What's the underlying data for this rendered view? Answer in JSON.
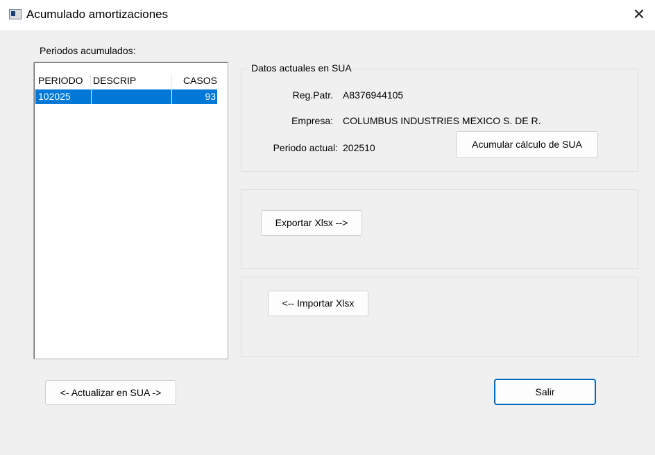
{
  "window": {
    "title": "Acumulado amortizaciones",
    "icon": "app-window-icon",
    "close_glyph": "✕"
  },
  "periods": {
    "label": "Periodos acumulados:",
    "columns": [
      "PERIODO",
      "DESCRIP",
      "CASOS"
    ],
    "rows": [
      {
        "periodo": "102025",
        "descrip": "",
        "casos": "93",
        "selected": true
      }
    ],
    "selection_color": "#0078d7"
  },
  "datos_sua": {
    "legend": "Datos actuales en SUA",
    "reg_patr_label": "Reg.Patr.",
    "reg_patr_value": "A8376944105",
    "empresa_label": "Empresa:",
    "empresa_value": "COLUMBUS INDUSTRIES MEXICO S. DE R.",
    "periodo_label": "Periodo actual:",
    "periodo_value": "202510",
    "acumular_button": "Acumular cálculo de SUA"
  },
  "export": {
    "button": "Exportar Xlsx  -->"
  },
  "import": {
    "button": "<-- Importar Xlsx"
  },
  "footer": {
    "actualizar_button": "<- Actualizar en SUA ->",
    "salir_button": "Salir",
    "focus_color": "#0067c0"
  }
}
